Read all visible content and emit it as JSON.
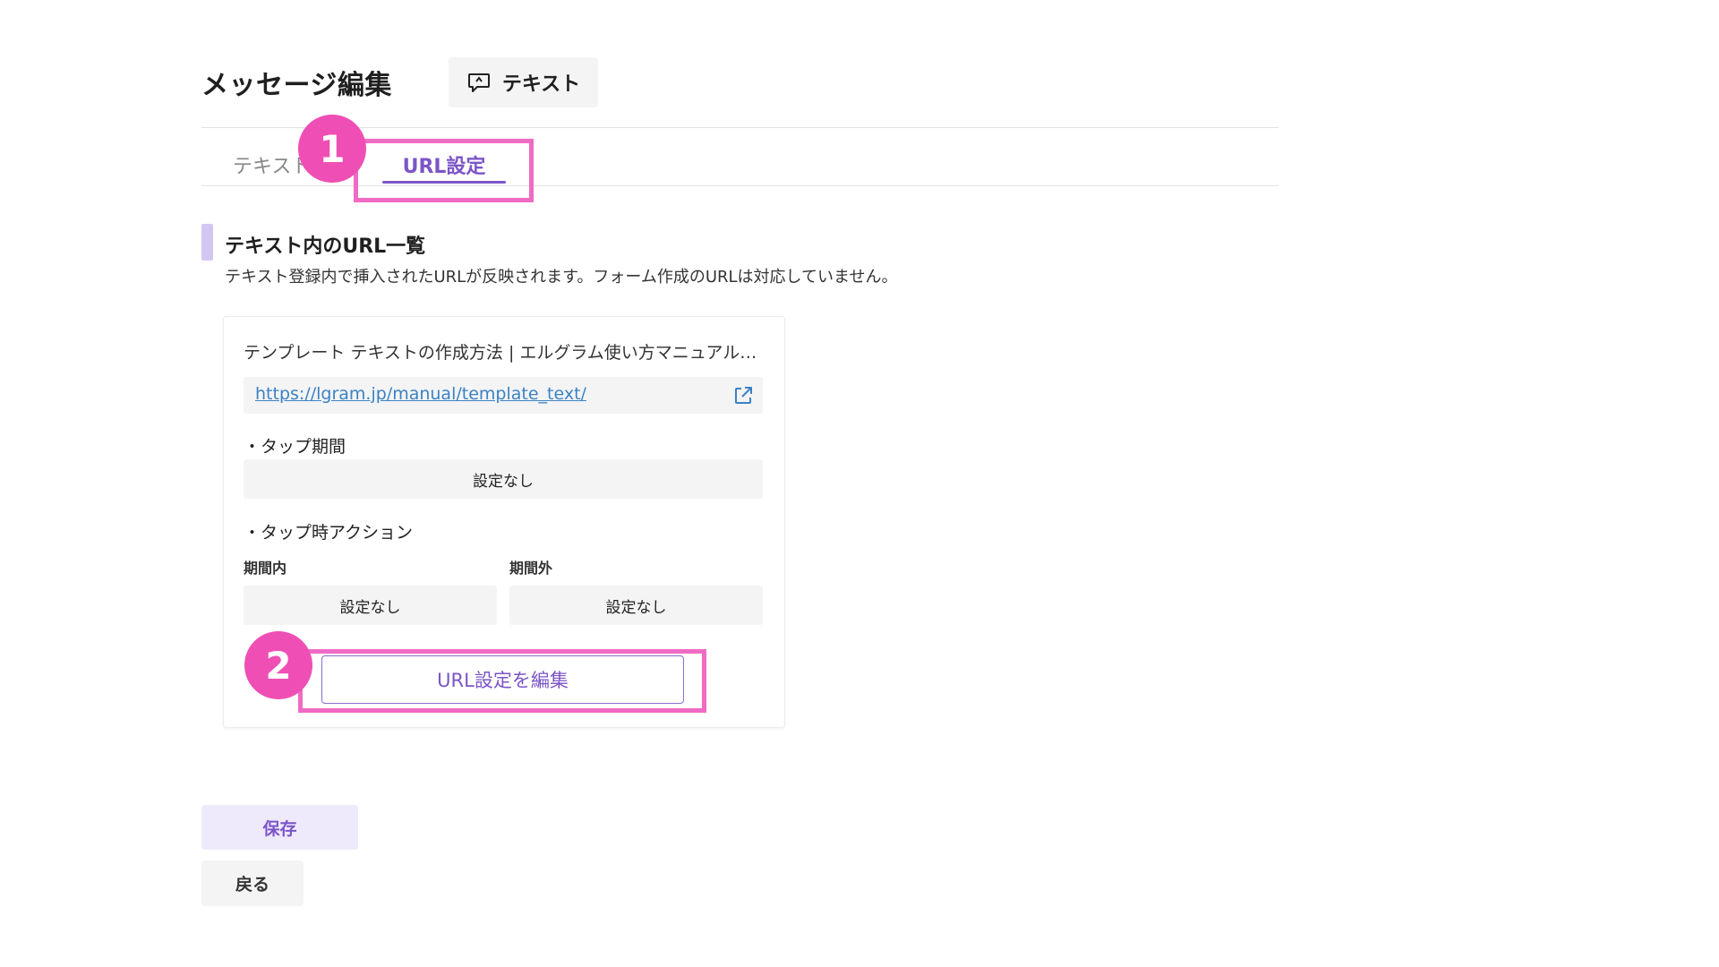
{
  "header": {
    "title": "メッセージ編集",
    "type_badge": "テキスト"
  },
  "tabs": [
    {
      "label": "テキスト",
      "active": false
    },
    {
      "label": "URL設定",
      "active": true
    }
  ],
  "section": {
    "title": "テキスト内のURL一覧",
    "description": "テキスト登録内で挿入されたURLが反映されます。フォーム作成のURLは対応していません。"
  },
  "url_card": {
    "title": "テンプレート テキストの作成方法 | エルグラム使い方マニュアル…",
    "url": "https://lgram.jp/manual/template_text/",
    "tap_period_label": "・タップ期間",
    "tap_period_value": "設定なし",
    "tap_action_label": "・タップ時アクション",
    "within_label": "期間内",
    "within_value": "設定なし",
    "outside_label": "期間外",
    "outside_value": "設定なし",
    "edit_button": "URL設定を編集"
  },
  "annotations": {
    "step1": "1",
    "step2": "2",
    "highlight_color": "#f06bc4",
    "badge_color": "#ef4fb4"
  },
  "footer": {
    "save_label": "保存",
    "back_label": "戻る"
  },
  "colors": {
    "accent": "#7b55c7",
    "link": "#3b82c4"
  },
  "icons": {
    "type_badge": "chat-bubble-icon",
    "url_external": "external-link-icon"
  }
}
